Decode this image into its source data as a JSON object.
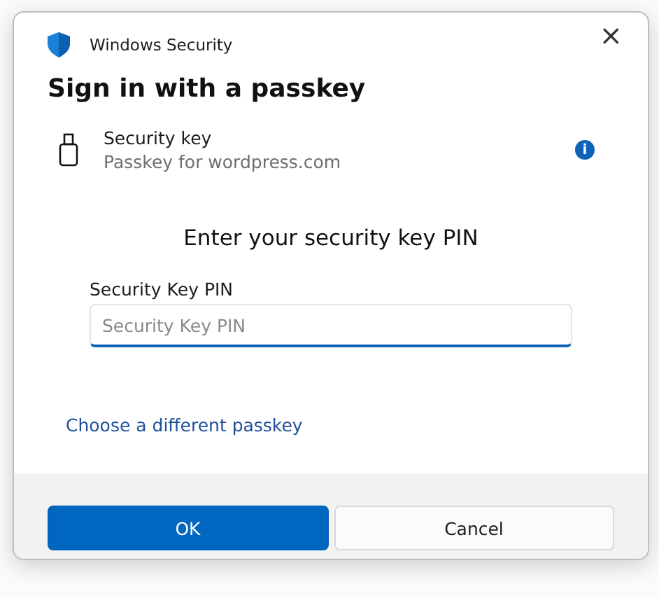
{
  "window": {
    "title": "Windows Security",
    "close": "×"
  },
  "heading": "Sign in with a passkey",
  "credential": {
    "name": "Security key",
    "detail": "Passkey for wordpress.com",
    "info": "i"
  },
  "prompt": "Enter your security key PIN",
  "pin_field": {
    "label": "Security Key PIN",
    "placeholder": "Security Key PIN"
  },
  "link": "Choose a different passkey",
  "buttons": [
    {
      "label": "OK",
      "kind": "primary"
    },
    {
      "label": "Cancel",
      "kind": "secondary"
    }
  ]
}
